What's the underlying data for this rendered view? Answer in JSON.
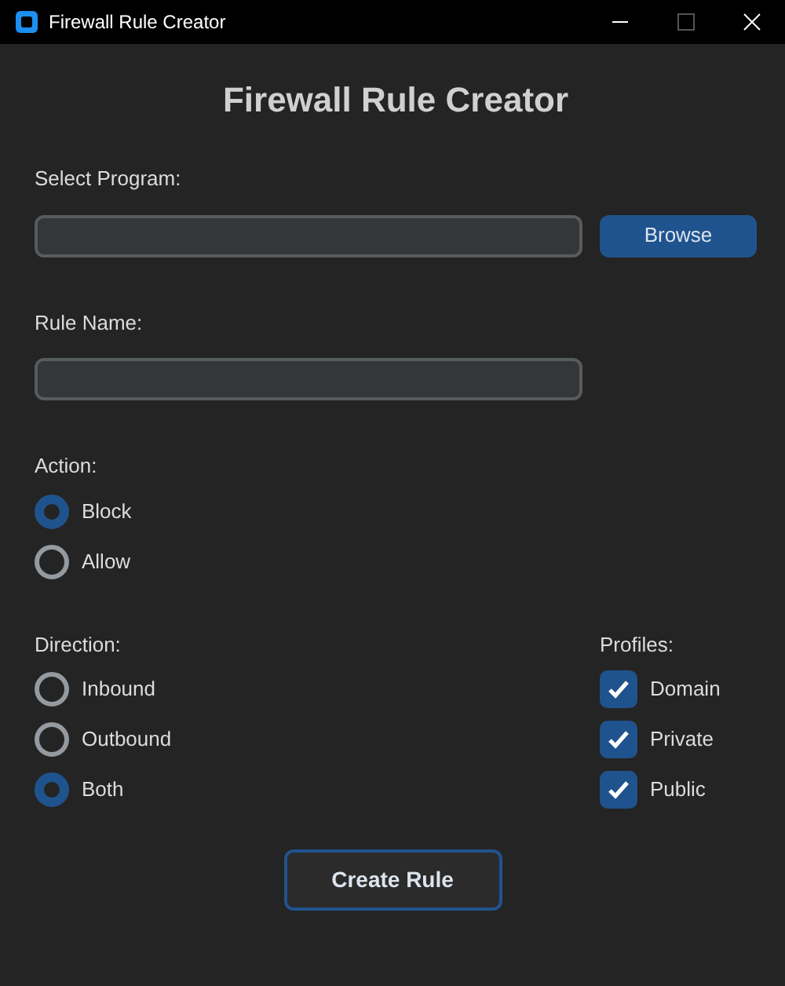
{
  "window": {
    "title": "Firewall Rule Creator"
  },
  "heading": "Firewall Rule Creator",
  "program": {
    "label": "Select Program:",
    "button": "Browse"
  },
  "rule_name": {
    "label": "Rule Name:"
  },
  "action": {
    "label": "Action:",
    "options": [
      {
        "label": "Block",
        "selected": true
      },
      {
        "label": "Allow",
        "selected": false
      }
    ]
  },
  "direction": {
    "label": "Direction:",
    "options": [
      {
        "label": "Inbound",
        "selected": false
      },
      {
        "label": "Outbound",
        "selected": false
      },
      {
        "label": "Both",
        "selected": true
      }
    ]
  },
  "profiles": {
    "label": "Profiles:",
    "items": [
      {
        "label": "Domain",
        "checked": true
      },
      {
        "label": "Private",
        "checked": true
      },
      {
        "label": "Public",
        "checked": true
      }
    ]
  },
  "create_button": "Create Rule"
}
